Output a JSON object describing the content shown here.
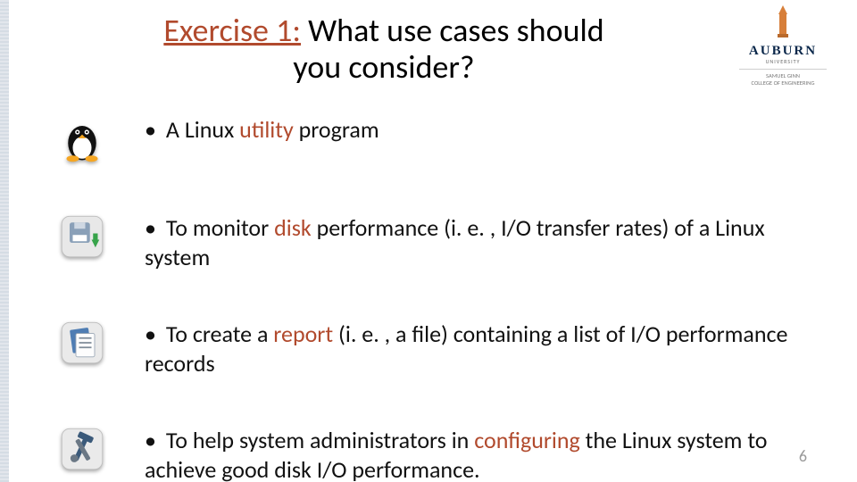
{
  "logo": {
    "name": "AUBURN",
    "sub": "UNIVERSITY",
    "college_line1": "SAMUEL GINN",
    "college_line2": "COLLEGE OF ENGINEERING"
  },
  "title": {
    "accent_prefix": "Exercise 1:",
    "rest_line1": " What use cases should",
    "line2": "you consider?"
  },
  "bullets": [
    {
      "icon": "linux-penguin-icon",
      "pre": "A Linux ",
      "hl": "utility",
      "post": " program"
    },
    {
      "icon": "disk-download-icon",
      "pre": "To monitor ",
      "hl": "disk",
      "post": " performance (i. e. , I/O transfer rates) of a Linux system"
    },
    {
      "icon": "documents-icon",
      "pre": "To create a ",
      "hl": "report",
      "post": " (i. e. , a file) containing a list of I/O performance records"
    },
    {
      "icon": "tools-icon",
      "pre": "To help system administrators in ",
      "hl": "configuring",
      "post": " the Linux system to achieve good disk I/O performance."
    }
  ],
  "page_number": "6"
}
